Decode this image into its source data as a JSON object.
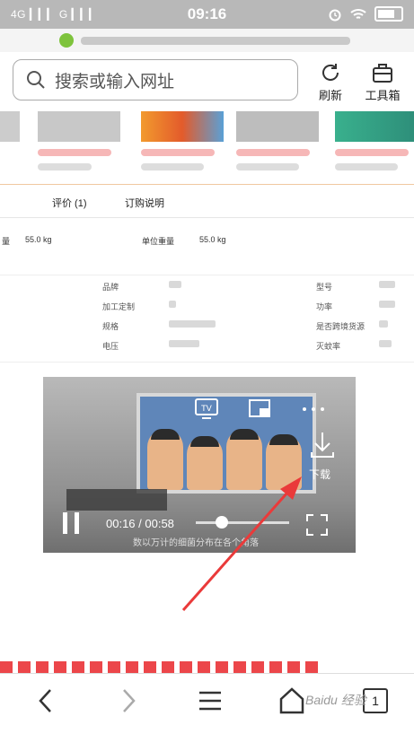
{
  "status_bar": {
    "signal_left": "4G ▎▎▎ G ▎▎▎",
    "time": "09:16",
    "icons": [
      "alarm-icon",
      "wifi-icon",
      "battery-icon"
    ]
  },
  "search": {
    "placeholder": "搜索或输入网址"
  },
  "toolbar": {
    "refresh_label": "刷新",
    "toolbox_label": "工具箱"
  },
  "tabs": {
    "review": "评价 (1)",
    "order_note": "订购说明"
  },
  "weights": {
    "left_label": "量",
    "left_value": "55.0 kg",
    "unit_label": "单位重量",
    "unit_value": "55.0 kg"
  },
  "specs": {
    "col1": [
      "品牌",
      "加工定制",
      "规格",
      "电压"
    ],
    "col2": [
      "型号",
      "功率",
      "是否跨境货源",
      "灭蚊率"
    ]
  },
  "video": {
    "time": "00:16 / 00:58",
    "download_label": "下载",
    "subtitle": "数以万计的细菌分布在各个角落",
    "progress_fraction": 0.276
  },
  "bottom_nav": {
    "tab_count": "1"
  },
  "watermark": "Baidu 经验"
}
